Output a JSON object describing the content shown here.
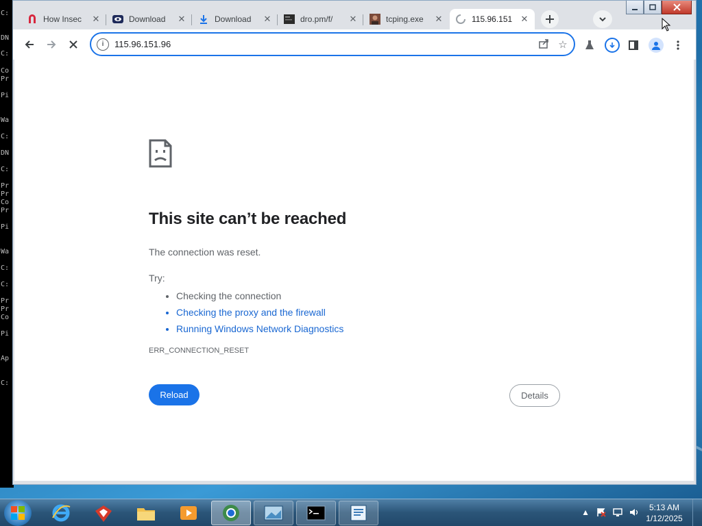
{
  "cmd_window": {
    "lines": [
      "C:",
      "DN",
      "C:",
      "Co",
      "Pr",
      "Pi",
      "Wa",
      "C:",
      "DN",
      "C:",
      "Pr",
      "Pr",
      "Co",
      "Pr",
      "Pi",
      "Wa",
      "C:",
      "C:",
      "Pr",
      "Pr",
      "Co",
      "Pi",
      "Ap",
      "C:"
    ]
  },
  "tabs": [
    {
      "title": "How Insec",
      "favicon": "red-n-icon"
    },
    {
      "title": "Download",
      "favicon": "eye-logo-icon"
    },
    {
      "title": "Download",
      "favicon": "download-arrow-icon"
    },
    {
      "title": "dro.pm/f/",
      "favicon": "terminal-thumbnail-icon"
    },
    {
      "title": "tcping.exe",
      "favicon": "avatar-photo-icon"
    },
    {
      "title": "115.96.151",
      "favicon": "loading-spinner-icon"
    }
  ],
  "toolbar": {
    "url": "115.96.151.96"
  },
  "error_page": {
    "title": "This site can’t be reached",
    "subtitle": "The connection was reset.",
    "try_label": "Try:",
    "suggestions": [
      "Checking the connection",
      "Checking the proxy and the firewall",
      "Running Windows Network Diagnostics"
    ],
    "error_code": "ERR_CONNECTION_RESET",
    "reload_label": "Reload",
    "details_label": "Details"
  },
  "taskbar": {
    "time": "5:13 AM",
    "date": "1/12/2025"
  },
  "colors": {
    "accent": "#1a73e8",
    "link": "#1967d2",
    "close": "#c0392b"
  }
}
